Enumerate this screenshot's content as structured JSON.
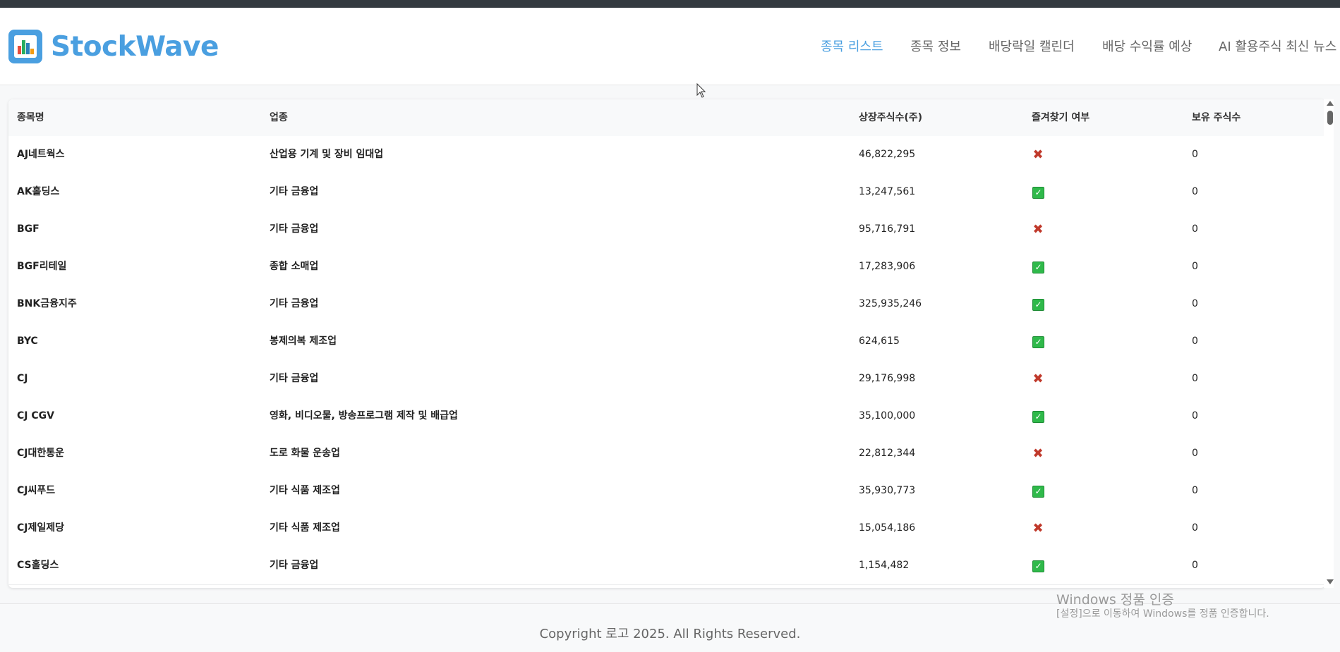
{
  "brand": {
    "name": "StockWave",
    "logo_icon": "bar-chart-icon"
  },
  "nav": {
    "items": [
      {
        "label": "종목 리스트",
        "active": true
      },
      {
        "label": "종목 정보",
        "active": false
      },
      {
        "label": "배당락일 캘린더",
        "active": false
      },
      {
        "label": "배당 수익률 예상",
        "active": false
      },
      {
        "label": "AI 활용주식 최신 뉴스",
        "active": false
      }
    ]
  },
  "table": {
    "headers": {
      "name": "종목명",
      "sector": "업종",
      "shares": "상장주식수(주)",
      "favorite": "즐겨찾기 여부",
      "holding": "보유 주식수"
    },
    "rows": [
      {
        "name": "AJ네트웍스",
        "sector": "산업용 기계 및 장비 임대업",
        "shares": "46,822,295",
        "favorite": false,
        "holding": "0"
      },
      {
        "name": "AK홀딩스",
        "sector": "기타 금융업",
        "shares": "13,247,561",
        "favorite": true,
        "holding": "0"
      },
      {
        "name": "BGF",
        "sector": "기타 금융업",
        "shares": "95,716,791",
        "favorite": false,
        "holding": "0"
      },
      {
        "name": "BGF리테일",
        "sector": "종합 소매업",
        "shares": "17,283,906",
        "favorite": true,
        "holding": "0"
      },
      {
        "name": "BNK금융지주",
        "sector": "기타 금융업",
        "shares": "325,935,246",
        "favorite": true,
        "holding": "0"
      },
      {
        "name": "BYC",
        "sector": "봉제의복 제조업",
        "shares": "624,615",
        "favorite": true,
        "holding": "0"
      },
      {
        "name": "CJ",
        "sector": "기타 금융업",
        "shares": "29,176,998",
        "favorite": false,
        "holding": "0"
      },
      {
        "name": "CJ CGV",
        "sector": "영화, 비디오물, 방송프로그램 제작 및 배급업",
        "shares": "35,100,000",
        "favorite": true,
        "holding": "0"
      },
      {
        "name": "CJ대한통운",
        "sector": "도로 화물 운송업",
        "shares": "22,812,344",
        "favorite": false,
        "holding": "0"
      },
      {
        "name": "CJ씨푸드",
        "sector": "기타 식품 제조업",
        "shares": "35,930,773",
        "favorite": true,
        "holding": "0"
      },
      {
        "name": "CJ제일제당",
        "sector": "기타 식품 제조업",
        "shares": "15,054,186",
        "favorite": false,
        "holding": "0"
      },
      {
        "name": "CS홀딩스",
        "sector": "기타 금융업",
        "shares": "1,154,482",
        "favorite": true,
        "holding": "0"
      }
    ]
  },
  "footer": {
    "copyright": "Copyright 로고 2025. All Rights Reserved."
  },
  "watermark": {
    "title": "Windows 정품 인증",
    "subtitle": "[설정]으로 이동하여 Windows를 정품 인증합니다."
  },
  "colors": {
    "accent": "#4a9fe0",
    "check": "#2fb94a",
    "cross": "#c0392b"
  }
}
